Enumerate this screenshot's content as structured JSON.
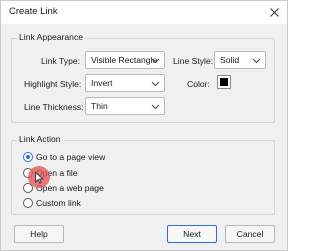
{
  "window": {
    "title": "Create Link"
  },
  "appearance": {
    "legend": "Link Appearance",
    "link_type": {
      "label": "Link Type:",
      "value": "Visible Rectangle"
    },
    "line_style": {
      "label": "Line Style:",
      "value": "Solid"
    },
    "highlight_style": {
      "label": "Highlight Style:",
      "value": "Invert"
    },
    "color": {
      "label": "Color:",
      "value": "#000000"
    },
    "line_thickness": {
      "label": "Line Thickness:",
      "value": "Thin"
    }
  },
  "action": {
    "legend": "Link Action",
    "options": [
      {
        "label": "Go to a page view",
        "checked": true
      },
      {
        "label": "Open a file",
        "checked": false
      },
      {
        "label": "Open a web page",
        "checked": false
      },
      {
        "label": "Custom link",
        "checked": false
      }
    ]
  },
  "buttons": {
    "help": "Help",
    "next": "Next",
    "cancel": "Cancel"
  },
  "icons": {
    "close": "close-icon",
    "chevron": "chevron-down-icon",
    "cursor": "mouse-pointer-icon"
  }
}
